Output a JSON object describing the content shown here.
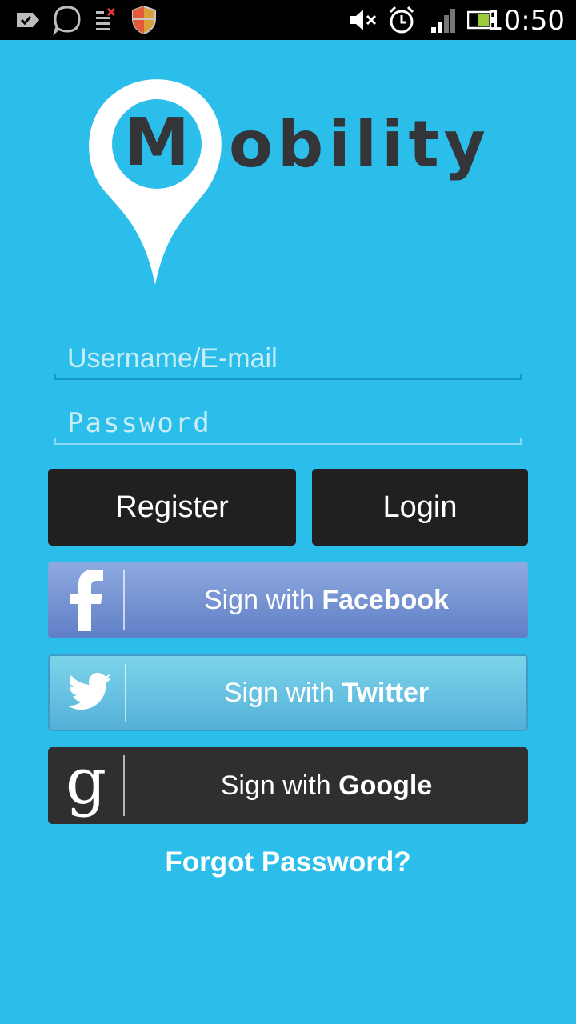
{
  "status_bar": {
    "icons": [
      "checkmark-badge-icon",
      "speech-bubble-icon",
      "task-list-icon",
      "shield-icon",
      "mute-icon",
      "alarm-clock-icon",
      "signal-icon",
      "battery-icon"
    ],
    "time": "10:50"
  },
  "logo": {
    "initial": "M",
    "word": "obility"
  },
  "form": {
    "username_placeholder": "Username/E-mail",
    "password_placeholder": "Password"
  },
  "buttons": {
    "register": "Register",
    "login": "Login"
  },
  "social": {
    "facebook": {
      "prefix": "Sign with ",
      "brand": "Facebook",
      "icon": "facebook-icon"
    },
    "twitter": {
      "prefix": "Sign with ",
      "brand": "Twitter",
      "icon": "twitter-bird-icon"
    },
    "google": {
      "prefix": "Sign with ",
      "brand": "Google",
      "icon": "google-icon"
    }
  },
  "forgot_password": "Forgot Password?",
  "colors": {
    "background": "#2cbeea",
    "dark_button": "#202020",
    "logo_text": "#333539",
    "facebook": "#6f8fd2",
    "twitter": "#68c3e2",
    "google": "#2f2f2f"
  }
}
